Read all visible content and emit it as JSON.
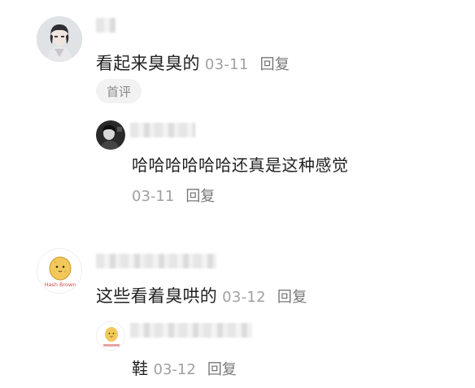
{
  "comments": [
    {
      "text": "看起来臭臭的",
      "date": "03-11",
      "reply_label": "回复",
      "badge": "首评",
      "avatar_icon": "anime-boy-avatar-icon",
      "reply": {
        "text": "哈哈哈哈哈哈还真是这种感觉",
        "date": "03-11",
        "reply_label": "回复",
        "avatar_icon": "dark-portrait-avatar-icon"
      }
    },
    {
      "text": "这些看着臭哄的",
      "date": "03-12",
      "reply_label": "回复",
      "avatar_icon": "potato-avatar-icon",
      "avatar_caption": "Hash Brown",
      "reply": {
        "text": "鞋",
        "date": "03-12",
        "reply_label": "回复",
        "avatar_icon": "potato-avatar-icon"
      }
    }
  ]
}
